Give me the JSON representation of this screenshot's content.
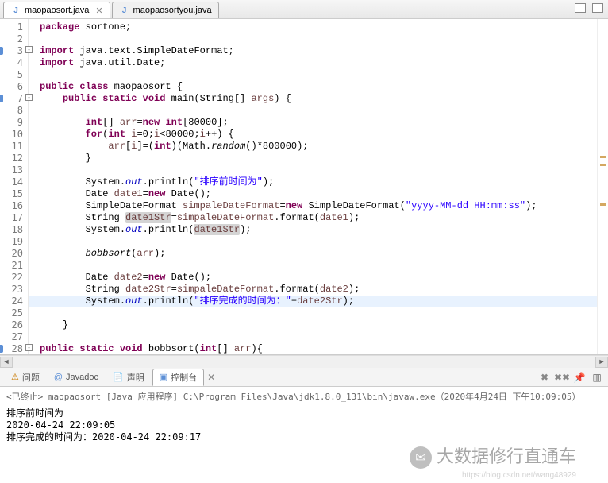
{
  "tabs": [
    {
      "icon": "J",
      "label": "maopaosort.java",
      "active": true
    },
    {
      "icon": "J",
      "label": "maopaosortyou.java",
      "active": false
    }
  ],
  "highlight_line_index": 23,
  "lines": [
    {
      "n": "1",
      "parts": [
        {
          "t": "package",
          "c": "kw"
        },
        {
          "t": " sortone;"
        }
      ]
    },
    {
      "n": "2",
      "parts": []
    },
    {
      "n": "3",
      "fold": "-",
      "marker": true,
      "parts": [
        {
          "t": "import",
          "c": "kw"
        },
        {
          "t": " java.text.SimpleDateFormat;"
        }
      ]
    },
    {
      "n": "4",
      "parts": [
        {
          "t": "import",
          "c": "kw"
        },
        {
          "t": " java.util.Date;"
        }
      ]
    },
    {
      "n": "5",
      "parts": []
    },
    {
      "n": "6",
      "parts": [
        {
          "t": "public class",
          "c": "kw"
        },
        {
          "t": " maopaosort {"
        }
      ]
    },
    {
      "n": "7",
      "fold": "-",
      "marker": true,
      "parts": [
        {
          "t": "    "
        },
        {
          "t": "public static void",
          "c": "kw"
        },
        {
          "t": " main(String[] "
        },
        {
          "t": "args",
          "c": "var"
        },
        {
          "t": ") {"
        }
      ]
    },
    {
      "n": "8",
      "parts": []
    },
    {
      "n": "9",
      "parts": [
        {
          "t": "        "
        },
        {
          "t": "int",
          "c": "kw"
        },
        {
          "t": "[] "
        },
        {
          "t": "arr",
          "c": "var"
        },
        {
          "t": "="
        },
        {
          "t": "new",
          "c": "kw"
        },
        {
          "t": " "
        },
        {
          "t": "int",
          "c": "kw"
        },
        {
          "t": "[80000];"
        }
      ]
    },
    {
      "n": "10",
      "parts": [
        {
          "t": "        "
        },
        {
          "t": "for",
          "c": "kw"
        },
        {
          "t": "("
        },
        {
          "t": "int",
          "c": "kw"
        },
        {
          "t": " "
        },
        {
          "t": "i",
          "c": "var"
        },
        {
          "t": "=0;"
        },
        {
          "t": "i",
          "c": "var"
        },
        {
          "t": "<80000;"
        },
        {
          "t": "i",
          "c": "var"
        },
        {
          "t": "++) {"
        }
      ]
    },
    {
      "n": "11",
      "parts": [
        {
          "t": "            "
        },
        {
          "t": "arr",
          "c": "var"
        },
        {
          "t": "["
        },
        {
          "t": "i",
          "c": "var"
        },
        {
          "t": "]=("
        },
        {
          "t": "int",
          "c": "kw"
        },
        {
          "t": ")(Math."
        },
        {
          "t": "random",
          "c": "smethod"
        },
        {
          "t": "()*800000);"
        }
      ]
    },
    {
      "n": "12",
      "parts": [
        {
          "t": "        }"
        }
      ]
    },
    {
      "n": "13",
      "parts": []
    },
    {
      "n": "14",
      "parts": [
        {
          "t": "        System."
        },
        {
          "t": "out",
          "c": "sfield"
        },
        {
          "t": ".println("
        },
        {
          "t": "\"排序前时间为\"",
          "c": "str"
        },
        {
          "t": ");"
        }
      ]
    },
    {
      "n": "15",
      "parts": [
        {
          "t": "        Date "
        },
        {
          "t": "date1",
          "c": "var"
        },
        {
          "t": "="
        },
        {
          "t": "new",
          "c": "kw"
        },
        {
          "t": " Date();"
        }
      ]
    },
    {
      "n": "16",
      "parts": [
        {
          "t": "        SimpleDateFormat "
        },
        {
          "t": "simpaleDateFormat",
          "c": "var"
        },
        {
          "t": "="
        },
        {
          "t": "new",
          "c": "kw"
        },
        {
          "t": " SimpleDateFormat("
        },
        {
          "t": "\"yyyy-MM-dd HH:mm:ss\"",
          "c": "str"
        },
        {
          "t": ");"
        }
      ]
    },
    {
      "n": "17",
      "parts": [
        {
          "t": "        String "
        },
        {
          "t": "date1Str",
          "c": "var mark"
        },
        {
          "t": "="
        },
        {
          "t": "simpaleDateFormat",
          "c": "var"
        },
        {
          "t": ".format("
        },
        {
          "t": "date1",
          "c": "var"
        },
        {
          "t": ");"
        }
      ]
    },
    {
      "n": "18",
      "parts": [
        {
          "t": "        System."
        },
        {
          "t": "out",
          "c": "sfield"
        },
        {
          "t": ".println("
        },
        {
          "t": "date1Str",
          "c": "var mark"
        },
        {
          "t": ");"
        }
      ]
    },
    {
      "n": "19",
      "parts": []
    },
    {
      "n": "20",
      "parts": [
        {
          "t": "        "
        },
        {
          "t": "bobbsort",
          "c": "smethod"
        },
        {
          "t": "("
        },
        {
          "t": "arr",
          "c": "var"
        },
        {
          "t": ");"
        }
      ]
    },
    {
      "n": "21",
      "parts": []
    },
    {
      "n": "22",
      "parts": [
        {
          "t": "        Date "
        },
        {
          "t": "date2",
          "c": "var"
        },
        {
          "t": "="
        },
        {
          "t": "new",
          "c": "kw"
        },
        {
          "t": " Date();"
        }
      ]
    },
    {
      "n": "23",
      "parts": [
        {
          "t": "        String "
        },
        {
          "t": "date2Str",
          "c": "var"
        },
        {
          "t": "="
        },
        {
          "t": "simpaleDateFormat",
          "c": "var"
        },
        {
          "t": ".format("
        },
        {
          "t": "date2",
          "c": "var"
        },
        {
          "t": ");"
        }
      ]
    },
    {
      "n": "24",
      "parts": [
        {
          "t": "        System."
        },
        {
          "t": "out",
          "c": "sfield"
        },
        {
          "t": ".println("
        },
        {
          "t": "\"排序完成的时间为：\"",
          "c": "str"
        },
        {
          "t": "+"
        },
        {
          "t": "date2Str",
          "c": "var"
        },
        {
          "t": ");"
        }
      ]
    },
    {
      "n": "25",
      "parts": []
    },
    {
      "n": "26",
      "parts": [
        {
          "t": "    }"
        }
      ]
    },
    {
      "n": "27",
      "parts": []
    },
    {
      "n": "28",
      "fold": "-",
      "marker": true,
      "parts": [
        {
          "t": "public static void",
          "c": "kw"
        },
        {
          "t": " bobbsort("
        },
        {
          "t": "int",
          "c": "kw"
        },
        {
          "t": "[] "
        },
        {
          "t": "arr",
          "c": "var"
        },
        {
          "t": "){"
        }
      ]
    }
  ],
  "bottom_tabs": [
    {
      "icon": "⚠",
      "color": "#c97a00",
      "label": "问题",
      "active": false
    },
    {
      "icon": "@",
      "color": "#5c8fd6",
      "label": "Javadoc",
      "active": false
    },
    {
      "icon": "📄",
      "color": "#888",
      "label": "声明",
      "active": false
    },
    {
      "icon": "▣",
      "color": "#5c8fd6",
      "label": "控制台",
      "active": true
    }
  ],
  "console": {
    "header": "<已终止> maopaosort [Java 应用程序] C:\\Program Files\\Java\\jdk1.8.0_131\\bin\\javaw.exe（2020年4月24日 下午10:09:05）",
    "output": "排序前时间为\n2020-04-24 22:09:05\n排序完成的时间为：2020-04-24 22:09:17"
  },
  "watermark": {
    "brand": "大数据修行直通车",
    "url": "https://blog.csdn.net/wang48929"
  }
}
